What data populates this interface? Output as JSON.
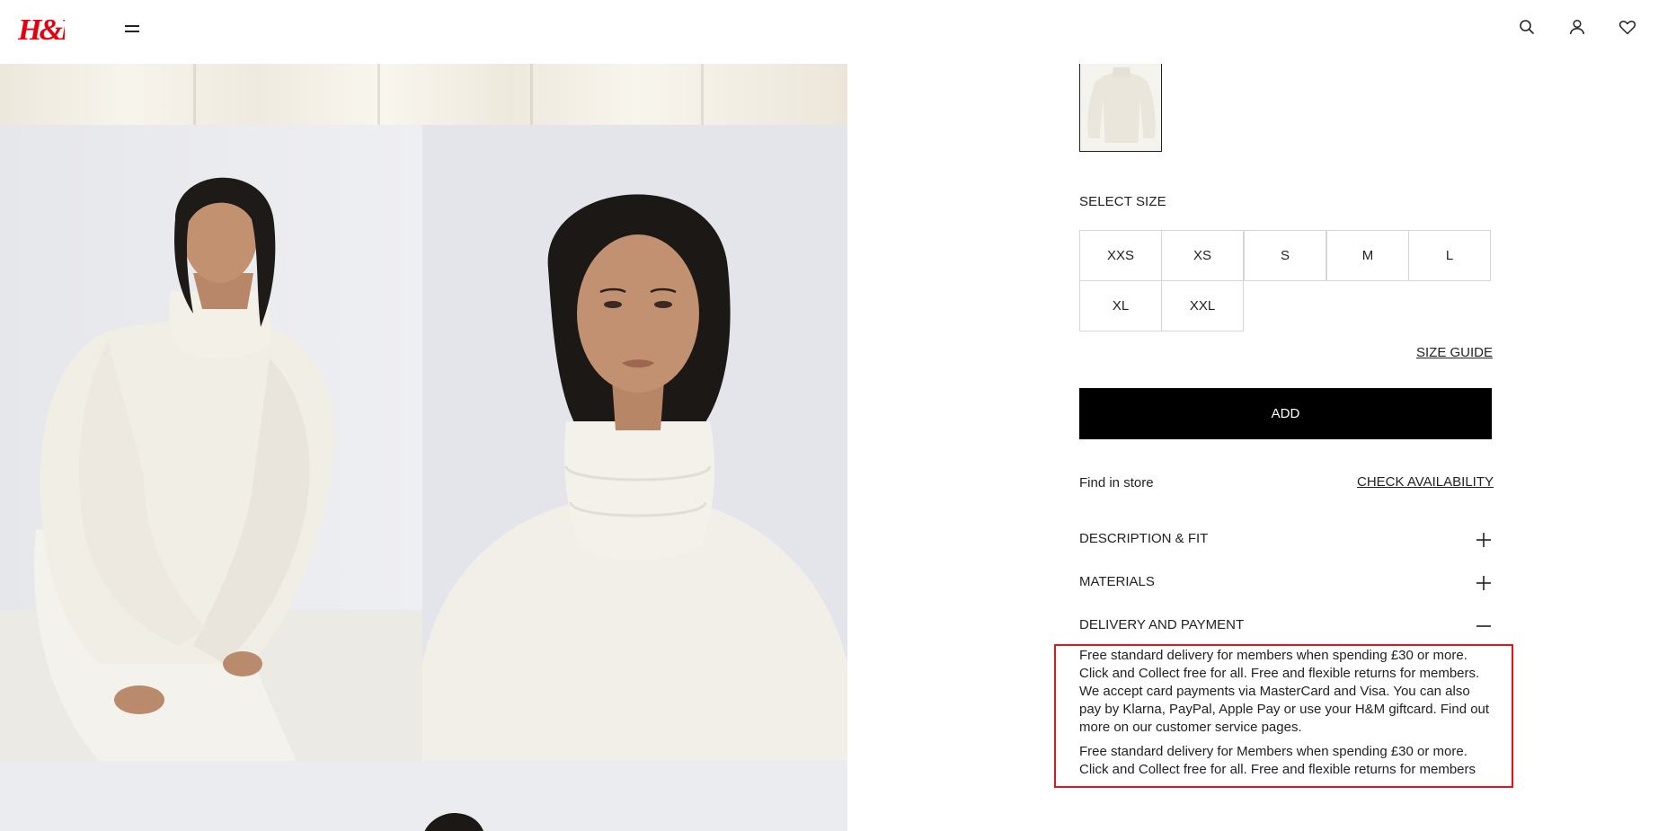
{
  "header": {
    "logo_text": "H&M",
    "icons": [
      "menu-icon",
      "search-icon",
      "account-icon",
      "heart-icon"
    ]
  },
  "gallery": {
    "images": [
      "product-image-top",
      "product-image-seated",
      "product-image-portrait",
      "product-image-bottom"
    ]
  },
  "product": {
    "select_size_label": "SELECT SIZE",
    "sizes": [
      "XXS",
      "XS",
      "S",
      "M",
      "L",
      "XL",
      "XXL"
    ],
    "size_guide_label": "SIZE GUIDE",
    "add_label": "ADD",
    "find_in_store_label": "Find in store",
    "check_availability_label": "CHECK AVAILABILITY"
  },
  "accordion": [
    {
      "label": "DESCRIPTION & FIT",
      "state": "collapsed"
    },
    {
      "label": "MATERIALS",
      "state": "collapsed"
    },
    {
      "label": "DELIVERY AND PAYMENT",
      "state": "expanded"
    }
  ],
  "delivery": {
    "paragraph_1": "Free standard delivery for members when spending £30 or more. Click and Collect free for all. Free and flexible returns for members. We accept card payments via MasterCard and Visa. You can also pay by Klarna, PayPal, Apple Pay or use your H&M giftcard. Find out more on our customer service pages.",
    "paragraph_2": "Free standard delivery for Members when spending £30 or more. Click and Collect free for all. Free and flexible returns for members"
  },
  "colors": {
    "brand_red": "#e50010",
    "highlight_red": "#e3141c",
    "button_black": "#000000"
  }
}
